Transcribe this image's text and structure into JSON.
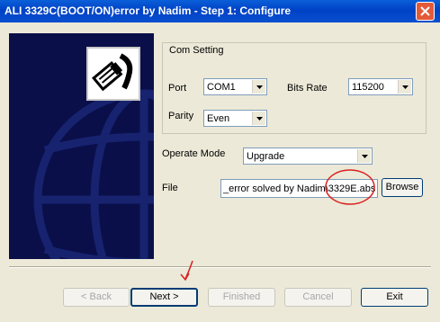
{
  "window": {
    "title": "ALI 3329C(BOOT/ON)error by Nadim    - Step 1: Configure"
  },
  "com_setting": {
    "legend": "Com Setting",
    "port_label": "Port",
    "port_value": "COM1",
    "bits_rate_label": "Bits Rate",
    "bits_rate_value": "115200",
    "parity_label": "Parity",
    "parity_value": "Even"
  },
  "operate_mode": {
    "label": "Operate Mode",
    "value": "Upgrade"
  },
  "file": {
    "label": "File",
    "value": "_error solved by Nadim\\3329E.abs",
    "browse_label": "Browse"
  },
  "buttons": {
    "back": "< Back",
    "next": "Next >",
    "finished": "Finished",
    "cancel": "Cancel",
    "exit": "Exit"
  },
  "states": {
    "back_enabled": false,
    "finished_enabled": false,
    "cancel_enabled": false
  },
  "colors": {
    "title_bar": "#0a4fd0",
    "panel_bg": "#0a0f4a",
    "annotation_red": "#d92020"
  },
  "icons": [
    "close-icon",
    "network-cable-icon",
    "globe-graphic"
  ]
}
